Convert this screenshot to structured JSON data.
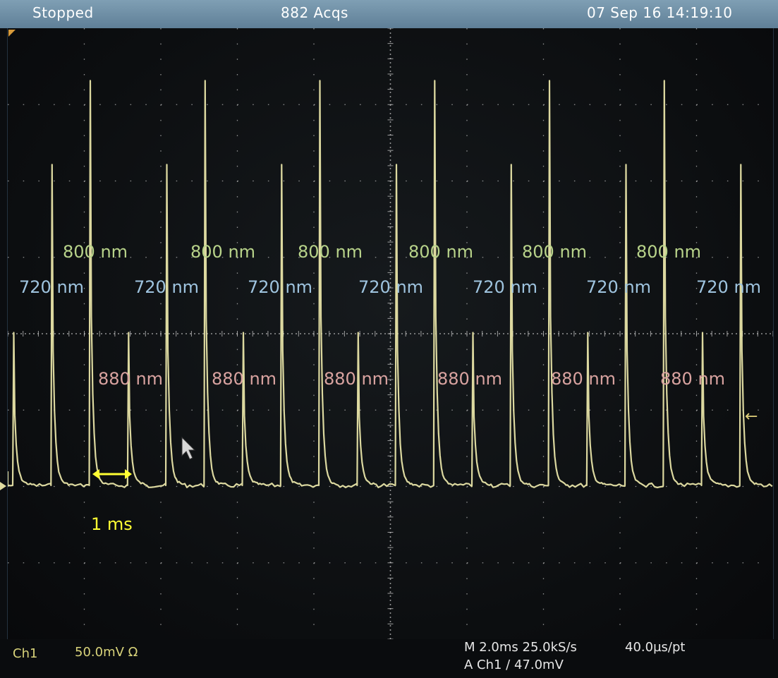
{
  "status": {
    "state": "Stopped",
    "acquisitions": "882 Acqs",
    "datetime": "07 Sep 16 14:19:10"
  },
  "bottom": {
    "channel": "Ch1",
    "scale": "50.0mV Ω",
    "timebase": "M 2.0ms 25.0kS/s",
    "record": "40.0µs/pt",
    "trigger": "A Ch1 ∕ 47.0mV"
  },
  "annotations": {
    "scale_bar": "1 ms",
    "labels_800": [
      "800 nm",
      "800 nm",
      "800 nm",
      "800 nm",
      "800 nm",
      "800 nm"
    ],
    "labels_720": [
      "720 nm",
      "720 nm",
      "720 nm",
      "720 nm",
      "720 nm",
      "720 nm",
      "720 nm"
    ],
    "labels_880": [
      "880 nm",
      "880 nm",
      "880 nm",
      "880 nm",
      "880 nm",
      "880 nm"
    ]
  },
  "colors": {
    "trace": "#e8e4a8",
    "label_800": "#b8d38a",
    "label_720": "#9fc4df",
    "label_880": "#d9a3a0",
    "scale_bar": "#ffff33",
    "grid": "#bfbfbf",
    "topbar": "#6f90a6"
  },
  "chart_data": {
    "type": "line",
    "xlabel": "",
    "ylabel": "",
    "pulse_sequence": [
      "880 nm",
      "720 nm",
      "800 nm"
    ],
    "pulse_amplitude_divisions": [
      2.0,
      4.2,
      5.3
    ],
    "baseline_division": 0.0
  }
}
